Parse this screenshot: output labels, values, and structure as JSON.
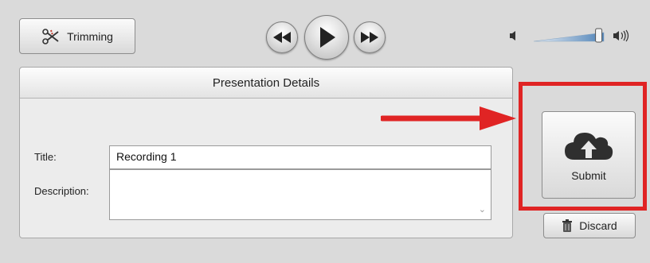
{
  "toolbar": {
    "trimming_label": "Trimming",
    "icons": {
      "trimming": "scissors-icon",
      "rewind": "rewind-icon",
      "play": "play-icon",
      "fast_forward": "fast-forward-icon",
      "volume_low": "speaker-low-icon",
      "volume_high": "speaker-high-icon"
    },
    "volume_level": 0.85
  },
  "details": {
    "heading": "Presentation Details",
    "title_label": "Title:",
    "title_value": "Recording 1",
    "description_label": "Description:",
    "description_value": ""
  },
  "actions": {
    "submit_label": "Submit",
    "discard_label": "Discard",
    "icons": {
      "submit": "cloud-upload-icon",
      "discard": "trash-icon"
    }
  },
  "annotation": {
    "highlight_color": "#e02424",
    "arrow_color": "#e02424"
  }
}
